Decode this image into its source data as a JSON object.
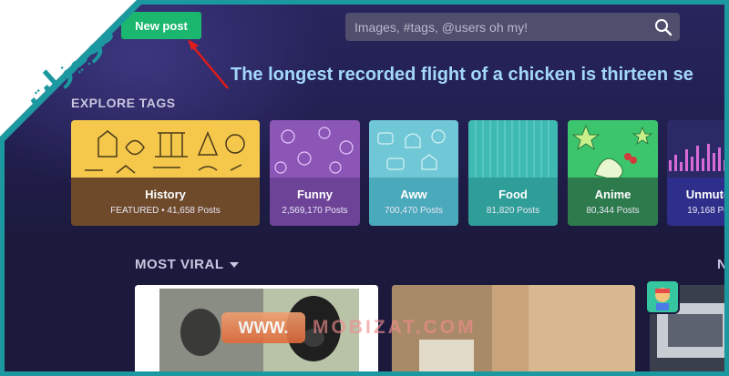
{
  "header": {
    "new_post_label": "New post",
    "search_placeholder": "Images, #tags, @users oh my!"
  },
  "fact_banner": "The longest recorded flight of a chicken is thirteen se",
  "explore": {
    "title": "EXPLORE TAGS",
    "tags": [
      {
        "name": "History",
        "count": "FEATURED • 41,658 Posts",
        "color": "#6e4a2a",
        "art_color": "#f5c84c"
      },
      {
        "name": "Funny",
        "count": "2,569,170 Posts",
        "color": "#6d4398",
        "art_color": "#8c56b7"
      },
      {
        "name": "Aww",
        "count": "700,470 Posts",
        "color": "#4aa9ba",
        "art_color": "#70c7d5"
      },
      {
        "name": "Food",
        "count": "81,820 Posts",
        "color": "#2f9e98",
        "art_color": "#3fbab3"
      },
      {
        "name": "Anime",
        "count": "80,344 Posts",
        "color": "#2d7a4c",
        "art_color": "#3dc56d"
      },
      {
        "name": "Unmute",
        "count": "19,168 Po",
        "color": "#2e2f8a",
        "art_color": "#2b2a66"
      }
    ]
  },
  "feed": {
    "title": "MOST VIRAL",
    "next_letter": "N",
    "card1_badge": "WWW.",
    "watermark": "MOBIZAT.COM"
  },
  "logo": {
    "text": "موبيزات"
  },
  "colors": {
    "accent_green": "#1bb76e",
    "frame_teal": "#1c98a0",
    "fact_blue": "#a3d7fb",
    "arrow_red": "#e01b1b"
  }
}
